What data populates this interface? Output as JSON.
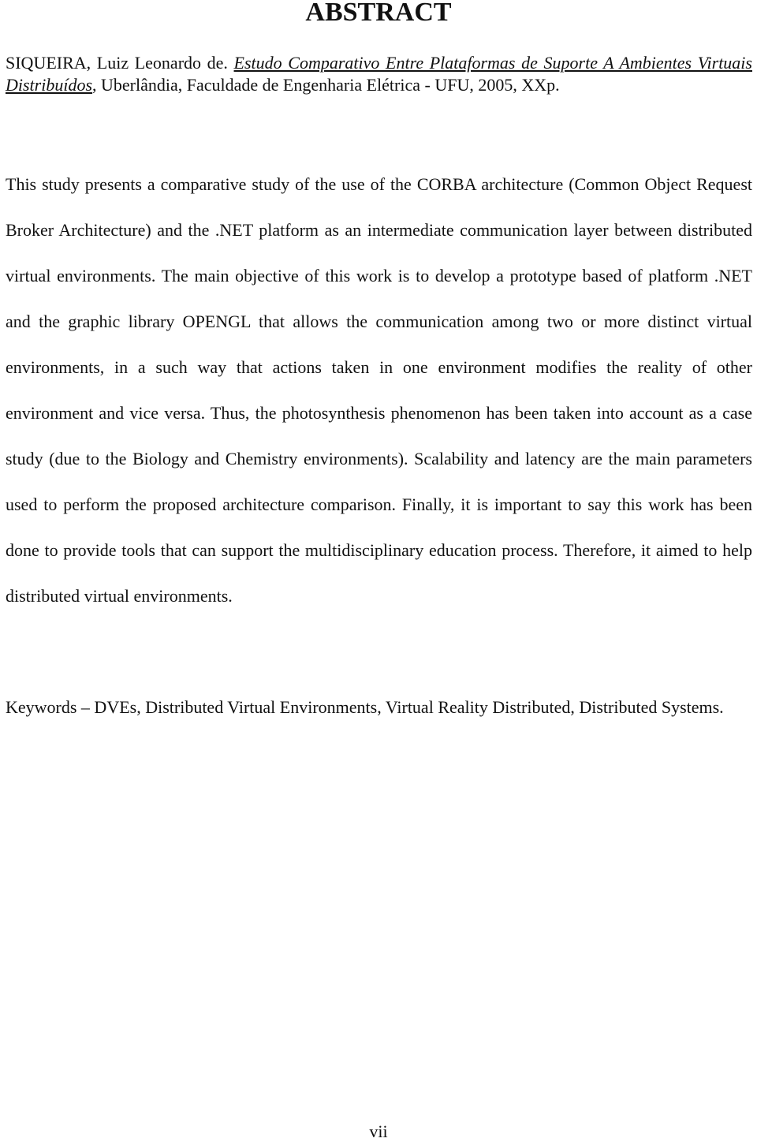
{
  "document": {
    "title": "ABSTRACT",
    "citation": {
      "author": "SIQUEIRA, Luiz Leonardo de. ",
      "work_title": "Estudo Comparativo Entre Plataformas de Suporte A Ambientes Virtuais Distribuídos",
      "publication": ", Uberlândia, Faculdade de Engenharia Elétrica - UFU, 2005, XXp."
    },
    "abstract_body": "This study presents a comparative study of the use of the CORBA architecture (Common Object Request Broker Architecture) and the .NET platform as an intermediate communication layer between distributed virtual environments. The main objective of this work is to develop a prototype based of platform .NET and the graphic library OPENGL that allows the communication among two or more distinct virtual environments, in a such way that actions taken in one environment modifies the reality of other environment and vice versa. Thus, the photosynthesis phenomenon has been taken into account as a case study (due to the Biology and Chemistry environments). Scalability and latency are the main parameters used to perform the proposed architecture comparison. Finally, it is important to say this work has been done to provide tools that can support the multidisciplinary education process. Therefore, it aimed to help distributed virtual environments.",
    "keywords": "Keywords – DVEs, Distributed Virtual Environments, Virtual Reality Distributed, Distributed Systems.",
    "page_number": "vii"
  }
}
